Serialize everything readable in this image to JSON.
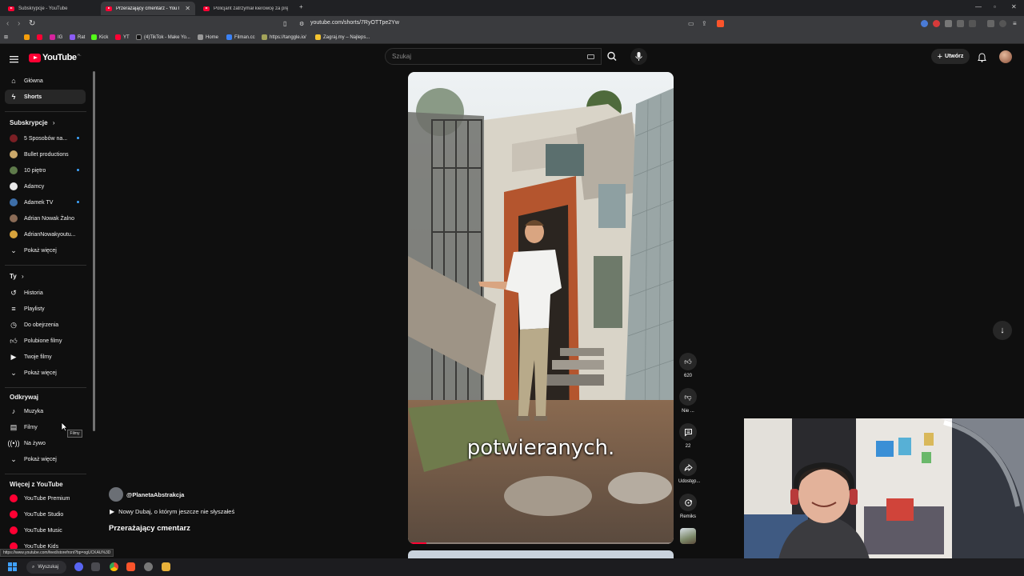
{
  "browser": {
    "tabs": [
      {
        "title": "Subskrypcje - YouTube",
        "active": false
      },
      {
        "title": "Przerażający cmentarz - YouTube",
        "active": true
      },
      {
        "title": "Policjant zatrzymał kierowcę za prędkość",
        "active": false
      }
    ],
    "url": "youtube.com/shorts/7RyOTTpe2Yw",
    "bookmarks": [
      "IG",
      "Rat",
      "Kick",
      "YT",
      "(4)TikTok - Make Yo...",
      "Home",
      "Filman.cc",
      "https://tanggle.io/",
      "Zagraj.my – Najleps..."
    ]
  },
  "masthead": {
    "logo_text": "YouTube",
    "logo_country": "PL",
    "search_placeholder": "Szukaj",
    "create_label": "Utwórz"
  },
  "sidebar": {
    "main": [
      {
        "label": "Główna",
        "icon": "home-icon"
      },
      {
        "label": "Shorts",
        "icon": "shorts-icon",
        "active": true
      }
    ],
    "subscriptions_title": "Subskrypcje",
    "subscriptions": [
      {
        "label": "5 Sposobów na...",
        "new": true,
        "color": "#7a1f24"
      },
      {
        "label": "Bullet productions",
        "new": false,
        "color": "#caa86a"
      },
      {
        "label": "10 piętro",
        "new": true,
        "color": "#5e7a4a"
      },
      {
        "label": "Adamcy",
        "new": false,
        "color": "#e8e8e8"
      },
      {
        "label": "Adamek TV",
        "new": true,
        "color": "#3d6ea8"
      },
      {
        "label": "Adrian Nowak Żalno",
        "new": false,
        "color": "#8a6b56"
      },
      {
        "label": "AdrianNowakyoutu...",
        "new": false,
        "color": "#d7a33c"
      }
    ],
    "show_more": "Pokaż więcej",
    "you_title": "Ty",
    "you": [
      {
        "label": "Historia",
        "icon": "history-icon"
      },
      {
        "label": "Playlisty",
        "icon": "playlists-icon"
      },
      {
        "label": "Do obejrzenia",
        "icon": "watch-later-icon"
      },
      {
        "label": "Polubione filmy",
        "icon": "liked-icon"
      },
      {
        "label": "Twoje filmy",
        "icon": "your-videos-icon"
      }
    ],
    "explore_title": "Odkrywaj",
    "explore": [
      {
        "label": "Muzyka",
        "icon": "music-icon"
      },
      {
        "label": "Filmy",
        "icon": "movies-icon"
      },
      {
        "label": "Na żywo",
        "icon": "live-icon"
      }
    ],
    "more_title": "Więcej z YouTube",
    "more": [
      {
        "label": "YouTube Premium"
      },
      {
        "label": "YouTube Studio"
      },
      {
        "label": "YouTube Music"
      },
      {
        "label": "YouTube Kids"
      }
    ],
    "tooltip": "Filmy"
  },
  "short": {
    "caption": "potwieranych.",
    "channel": "@PlanetaAbstrakcja",
    "linked_video": "Nowy Dubaj, o którym jeszcze nie słyszałeś",
    "title": "Przerażający cmentarz",
    "progress_fraction": 0.07,
    "actions": {
      "likes": "620",
      "dislike": "Nie ...",
      "comments": "22",
      "share": "Udostęp...",
      "remix": "Remiks"
    }
  },
  "status_url": "https://www.youtube.com/feed/storefront?bp=ogUCKAU%3D",
  "taskbar": {
    "search_label": "Wyszukaj"
  }
}
